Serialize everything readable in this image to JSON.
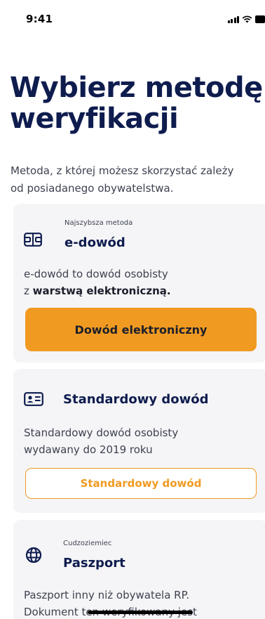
{
  "status_bar": {
    "time": "9:41",
    "icons": [
      "signal-icon",
      "wifi-icon",
      "battery-icon"
    ]
  },
  "page": {
    "title_line1": "Wybierz metodę",
    "title_line2": "weryfikacji",
    "subtitle_line1": "Metoda, z której możesz skorzystać zależy",
    "subtitle_line2": "od posiadanego obywatelstwa."
  },
  "methods": [
    {
      "icon": "id-chip-card-icon",
      "eyebrow": "Najszybsza metoda",
      "heading": "e-dowód",
      "desc_line1": "e-dowód to dowód osobisty",
      "desc_line2_prefix": "z ",
      "desc_line2_bold": "warstwą elektroniczną.",
      "button_label": "Dowód elektroniczny"
    },
    {
      "icon": "id-card-icon",
      "heading": "Standardowy dowód",
      "desc_line1": "Standardowy dowód osobisty",
      "desc_line2": "wydawany do 2019 roku",
      "button_label": "Standardowy dowód"
    },
    {
      "icon": "globe-icon",
      "eyebrow": "Cudzoziemiec",
      "heading": "Paszport",
      "desc_line1": "Paszport inny niż obywatela RP.",
      "desc_line2": "Dokument ten weryfikowany jest"
    }
  ],
  "colors": {
    "accent": "#f09a22",
    "heading": "#0e1c4e",
    "card_bg": "#f5f5f7",
    "body_text": "#3e4250"
  }
}
